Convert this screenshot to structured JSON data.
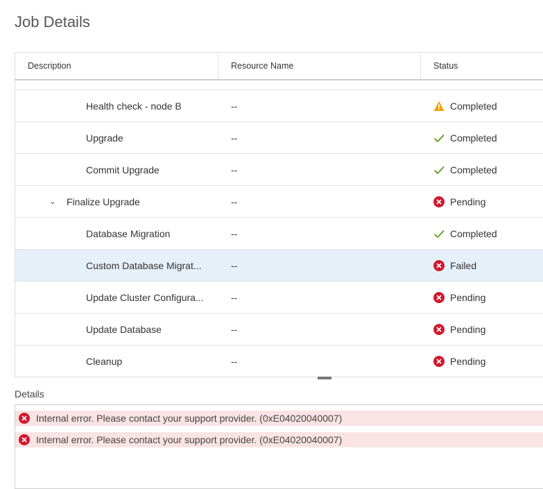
{
  "title": "Job Details",
  "columns": [
    "Description",
    "Resource Name",
    "Status"
  ],
  "rows": [
    {
      "description": "Health check - node B",
      "resource": "--",
      "status": "Completed",
      "icon": "warning"
    },
    {
      "description": "Upgrade",
      "resource": "--",
      "status": "Completed",
      "icon": "check"
    },
    {
      "description": "Commit Upgrade",
      "resource": "--",
      "status": "Completed",
      "icon": "check"
    },
    {
      "description": "Finalize Upgrade",
      "resource": "--",
      "status": "Pending",
      "icon": "error"
    },
    {
      "description": "Database Migration",
      "resource": "--",
      "status": "Completed",
      "icon": "check"
    },
    {
      "description": "Custom Database Migrat...",
      "resource": "--",
      "status": "Failed",
      "icon": "error"
    },
    {
      "description": "Update Cluster Configura...",
      "resource": "--",
      "status": "Pending",
      "icon": "error"
    },
    {
      "description": "Update Database",
      "resource": "--",
      "status": "Pending",
      "icon": "error"
    },
    {
      "description": "Cleanup",
      "resource": "--",
      "status": "Pending",
      "icon": "error"
    }
  ],
  "details": {
    "label": "Details",
    "messages": [
      "Internal error. Please contact your support provider. (0xE04020040007)",
      "Internal error. Please contact your support provider. (0xE04020040007)"
    ]
  },
  "colors": {
    "warning": "#f0a30a",
    "check": "#5a9a1a",
    "error": "#d0182f",
    "selected": "#e6f0f9",
    "errorBg": "#f9e3e5"
  }
}
